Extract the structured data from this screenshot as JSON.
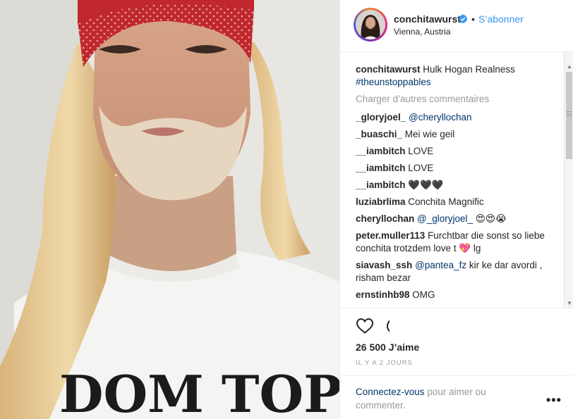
{
  "photo": {
    "shirt_text": "DOM TOP"
  },
  "header": {
    "username": "conchitawurst",
    "separator": "•",
    "follow_label": "S’abonner",
    "location": "Vienna, Austria"
  },
  "caption": {
    "username": "conchitawurst",
    "text": " Hulk Hogan Realness",
    "hashtag": "#theunstoppables"
  },
  "load_more_label": "Charger d’autres commentaires",
  "comments": [
    {
      "user": "_gloryjoel_",
      "mention": "@cheryllochan",
      "text": ""
    },
    {
      "user": "_buaschi_",
      "mention": "",
      "text": " Mei wie geil"
    },
    {
      "user": "__iambitch",
      "mention": "",
      "text": " LOVE"
    },
    {
      "user": "__iambitch",
      "mention": "",
      "text": " LOVE"
    },
    {
      "user": "__iambitch",
      "mention": "",
      "text": " 🖤🖤🖤"
    },
    {
      "user": "luziabrlima",
      "mention": "",
      "text": " Conchita Magnific"
    },
    {
      "user": "cheryllochan",
      "mention": "@_gloryjoel_",
      "text": " 😍😍😭"
    },
    {
      "user": "peter.muller113",
      "mention": "",
      "text": " Furchtbar die sonst so liebe conchita trotzdem love t 💖 lg"
    },
    {
      "user": "siavash_ssh",
      "mention": "@pantea_fz",
      "text": " kir ke dar avordi , risham bezar"
    },
    {
      "user": "ernstinhb98",
      "mention": "",
      "text": " OMG"
    }
  ],
  "icons": {
    "like": "heart-outline-icon",
    "comment": "speech-bubble-icon",
    "verified": "verified-badge-icon",
    "more": "more-options-icon"
  },
  "likes_label": "26 500 J’aime",
  "time_label": "IL Y A 2 JOURS",
  "login": {
    "link_label": "Connectez-vous",
    "rest": " pour aimer ou commenter."
  },
  "more_label": "•••",
  "colors": {
    "link_blue": "#3897f0",
    "mention_navy": "#003569",
    "muted": "#999999",
    "bandana_red": "#c0282e"
  }
}
